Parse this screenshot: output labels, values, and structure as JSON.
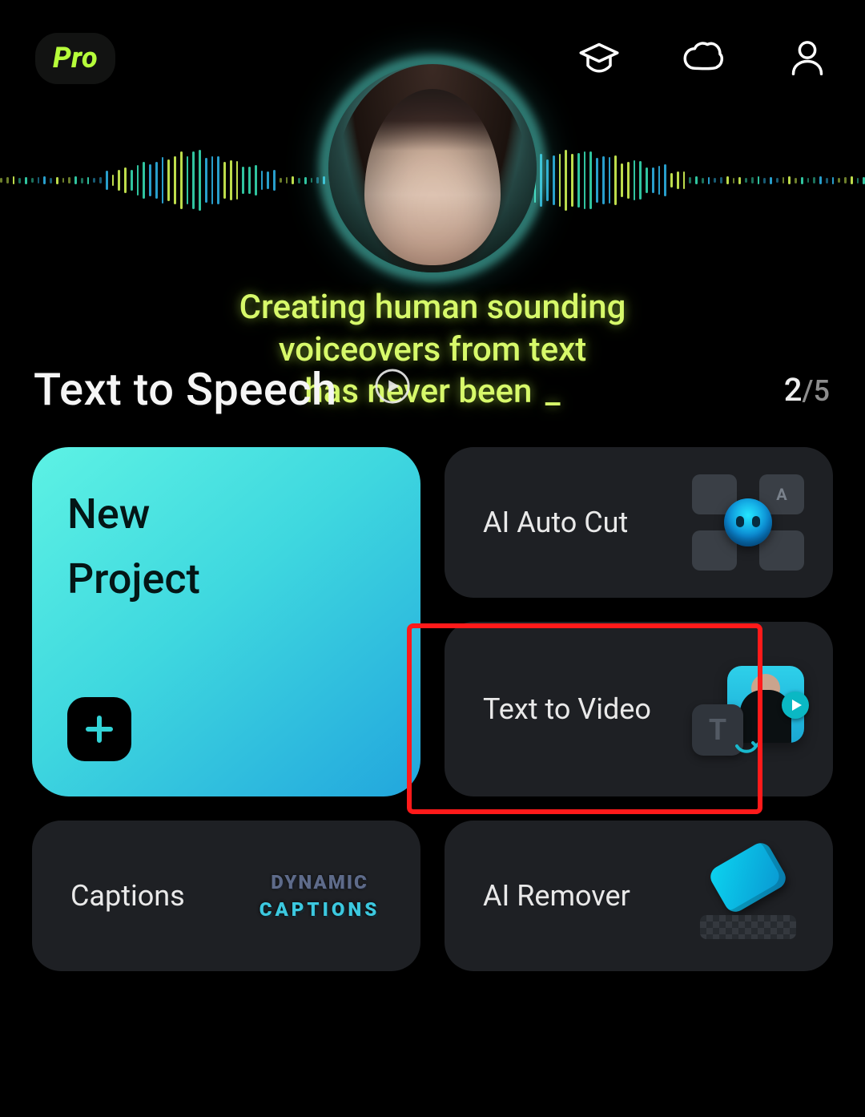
{
  "header": {
    "badge": "Pro",
    "icons": {
      "learn": "graduation-cap-icon",
      "cloud": "cloud-icon",
      "profile": "person-icon"
    }
  },
  "hero": {
    "title": "Text to Speech",
    "tagline_line1": "Creating human sounding",
    "tagline_line2": "voiceovers from text",
    "tagline_line3_prefix": "has never been ",
    "cursor": "_",
    "play_icon": "play-circle-icon",
    "pager_current": "2",
    "pager_total": "5"
  },
  "cards": {
    "new_project": {
      "line1": "New",
      "line2": "Project",
      "plus_icon": "plus-icon"
    },
    "ai_auto_cut": {
      "label": "AI Auto Cut",
      "thumb_letter": "A"
    },
    "text_to_video": {
      "label": "Text to Video",
      "t_glyph": "T"
    },
    "captions": {
      "label": "Captions",
      "thumb_line1": "DYNAMIC",
      "thumb_line2": "CAPTIONS"
    },
    "ai_remover": {
      "label": "AI Remover"
    }
  },
  "highlight": {
    "target": "text-to-video-card"
  }
}
